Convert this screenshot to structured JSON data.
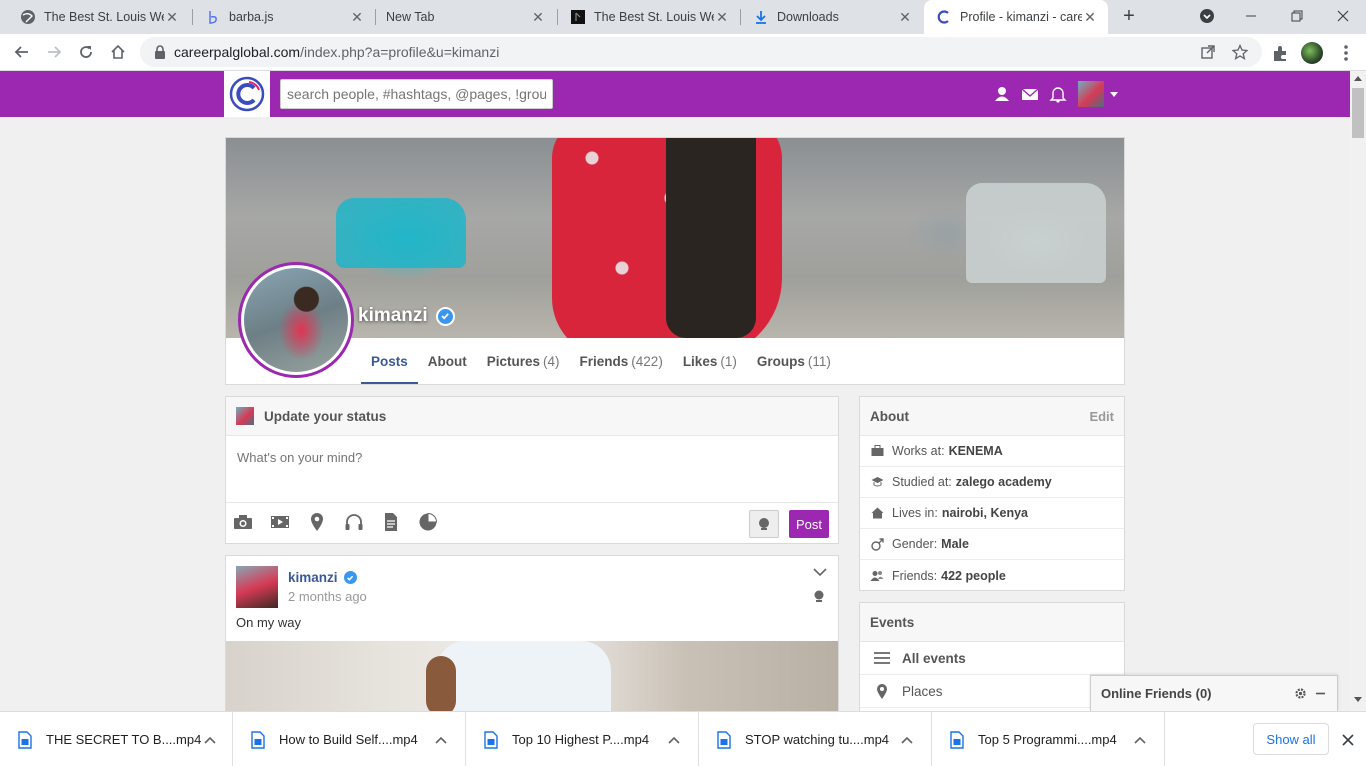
{
  "browser": {
    "tabs": [
      {
        "title": "The Best St. Louis Web",
        "icon": "globe-icon"
      },
      {
        "title": "barba.js",
        "icon": "barba-icon"
      },
      {
        "title": "New Tab",
        "icon": ""
      },
      {
        "title": "The Best St. Louis Web",
        "icon": "dark-site-icon"
      },
      {
        "title": "Downloads",
        "icon": "download-icon"
      },
      {
        "title": "Profile - kimanzi - care",
        "icon": "careerpal-icon",
        "active": true
      }
    ],
    "url_host": "careerpalglobal.com",
    "url_path": "/index.php?a=profile&u=kimanzi"
  },
  "site": {
    "search_placeholder": "search people, #hashtags, @pages, !groups",
    "brand_color": "#9c27b0"
  },
  "profile": {
    "name": "kimanzi",
    "tabs": [
      {
        "label": "Posts",
        "count": ""
      },
      {
        "label": "About",
        "count": ""
      },
      {
        "label": "Pictures",
        "count": "(4)"
      },
      {
        "label": "Friends",
        "count": "(422)"
      },
      {
        "label": "Likes",
        "count": "(1)"
      },
      {
        "label": "Groups",
        "count": "(11)"
      }
    ]
  },
  "status": {
    "title": "Update your status",
    "placeholder": "What's on your mind?",
    "post_label": "Post"
  },
  "post": {
    "author": "kimanzi",
    "time": "2 months ago",
    "text": "On my way"
  },
  "about": {
    "title": "About",
    "edit_label": "Edit",
    "rows": [
      {
        "label": "Works at:",
        "value": "KENEMA",
        "icon": "briefcase-icon"
      },
      {
        "label": "Studied at:",
        "value": "zalego academy",
        "icon": "graduation-icon"
      },
      {
        "label": "Lives in:",
        "value": "nairobi, Kenya",
        "icon": "home-icon"
      },
      {
        "label": "Gender:",
        "value": "Male",
        "icon": "male-icon"
      },
      {
        "label": "Friends:",
        "value": "422 people",
        "icon": "friends-icon"
      }
    ]
  },
  "events": {
    "title": "Events",
    "items": [
      {
        "label": "All events",
        "icon": "menu-icon"
      },
      {
        "label": "Places",
        "icon": "location-icon"
      }
    ]
  },
  "online_friends": {
    "title": "Online Friends (0)"
  },
  "downloads": {
    "items": [
      {
        "name": "THE SECRET TO B....mp4"
      },
      {
        "name": "How to Build Self....mp4"
      },
      {
        "name": "Top 10 Highest P....mp4"
      },
      {
        "name": "STOP watching tu....mp4"
      },
      {
        "name": "Top 5 Programmi....mp4"
      }
    ],
    "show_all_label": "Show all"
  }
}
